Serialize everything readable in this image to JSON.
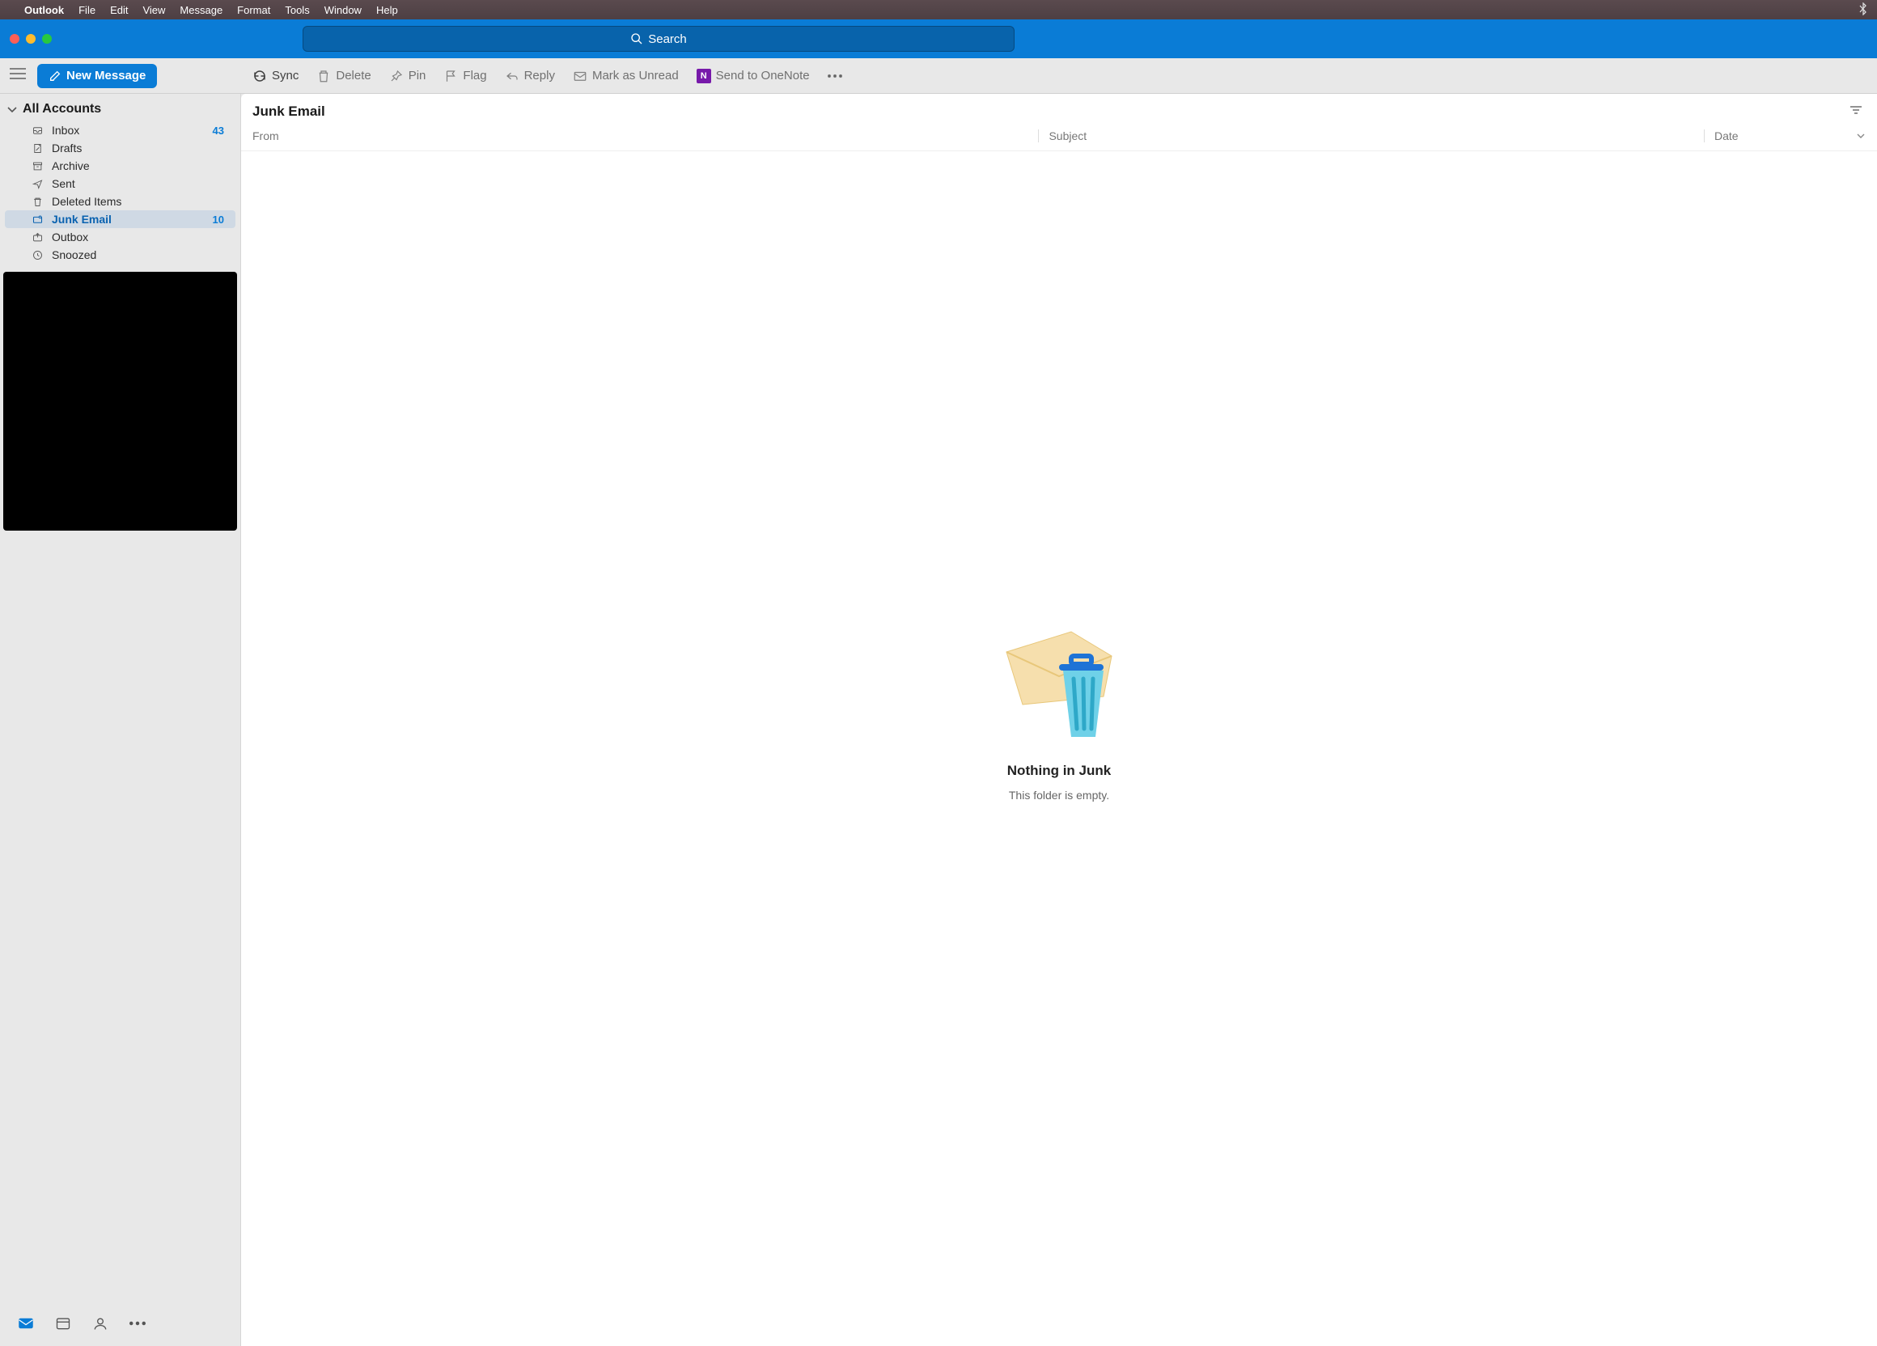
{
  "menubar": {
    "app": "Outlook",
    "items": [
      "File",
      "Edit",
      "View",
      "Message",
      "Format",
      "Tools",
      "Window",
      "Help"
    ]
  },
  "search": {
    "placeholder": "Search"
  },
  "newMessage": {
    "label": "New Message"
  },
  "toolbar": {
    "sync": "Sync",
    "delete": "Delete",
    "pin": "Pin",
    "flag": "Flag",
    "reply": "Reply",
    "markUnread": "Mark as Unread",
    "sendOneNote": "Send to OneNote"
  },
  "sidebar": {
    "header": "All Accounts",
    "folders": [
      {
        "name": "Inbox",
        "count": "43"
      },
      {
        "name": "Drafts",
        "count": ""
      },
      {
        "name": "Archive",
        "count": ""
      },
      {
        "name": "Sent",
        "count": ""
      },
      {
        "name": "Deleted Items",
        "count": ""
      },
      {
        "name": "Junk Email",
        "count": "10"
      },
      {
        "name": "Outbox",
        "count": ""
      },
      {
        "name": "Snoozed",
        "count": ""
      }
    ]
  },
  "content": {
    "title": "Junk Email",
    "columns": {
      "from": "From",
      "subject": "Subject",
      "date": "Date"
    },
    "empty": {
      "title": "Nothing in Junk",
      "sub": "This folder is empty."
    }
  }
}
